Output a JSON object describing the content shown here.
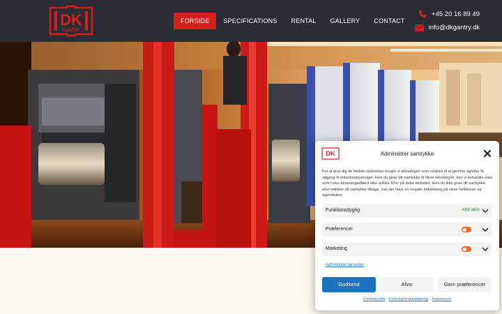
{
  "logo": {
    "text": "DK",
    "subtext": "GANTRY",
    "color": "#d4201c"
  },
  "nav": {
    "items": [
      {
        "label": "Forside",
        "active": true
      },
      {
        "label": "Specifications",
        "active": false
      },
      {
        "label": "Rental",
        "active": false
      },
      {
        "label": "Gallery",
        "active": false
      },
      {
        "label": "Contact",
        "active": false
      }
    ]
  },
  "contact": {
    "phone": "+45 20 16 89 49",
    "email": "info@dkgantry.dk",
    "phone_icon": "phone-icon",
    "email_icon": "envelope-icon"
  },
  "hero": {
    "image": "printing-press-photo"
  },
  "cookie": {
    "title": "Administrer samtykke",
    "body": "For at give dig de bedste oplevelser bruger vi teknologier som cookies til at gemme og/eller få adgang til enhedsoplysninger. Hvis du giver dit samtykke til disse teknologier, kan vi behandle data som f.eks. browsingadfærd eller unikke ID'er på dette websted. Hvis du ikke giver dit samtykke eller trækker dit samtykke tilbage, kan det have en negativ indvirkning på visse funktioner og egenskaber.",
    "categories": [
      {
        "label": "Funktionsdygtig",
        "status": "Altid aktiv"
      },
      {
        "label": "Præferencer",
        "status": ""
      },
      {
        "label": "Marketing",
        "status": ""
      }
    ],
    "manage_services": "Administrer tjenester",
    "accept": "Godkend",
    "deny": "Afvis",
    "save": "Gem præferencer",
    "links": [
      "Cookiepolitik",
      "Fortrolighedserklæring",
      "Impressum"
    ],
    "accent": "#1e73be",
    "toggle_color": "#f06a2a"
  }
}
